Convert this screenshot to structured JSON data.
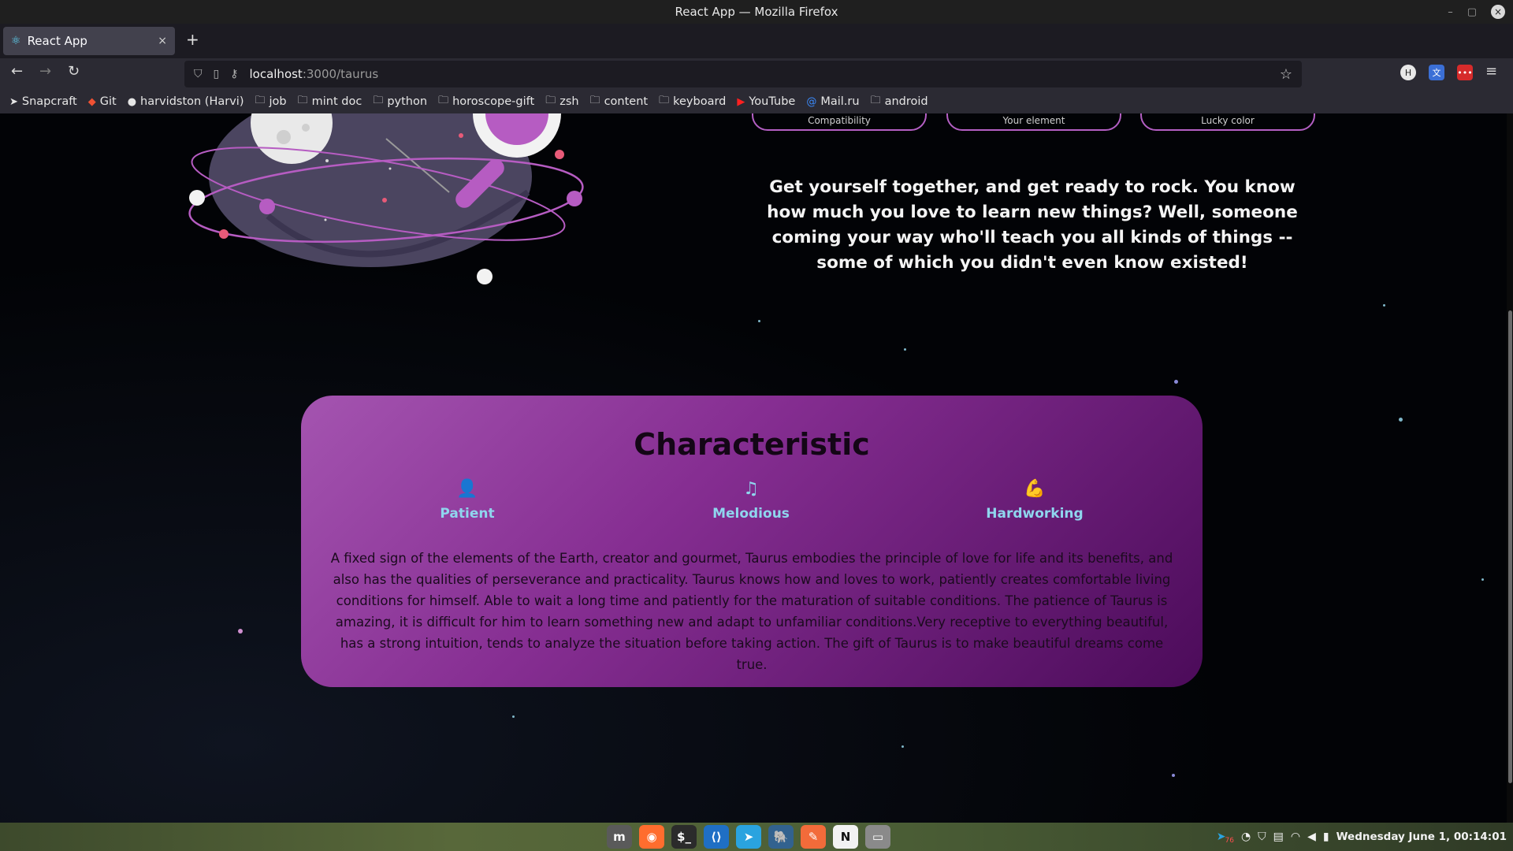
{
  "window": {
    "title": "React App — Mozilla Firefox",
    "minimize": "–",
    "maximize": "▢",
    "close": "×"
  },
  "tab": {
    "title": "React App",
    "close": "×",
    "new_tab": "+"
  },
  "nav": {
    "back": "←",
    "forward": "→",
    "reload": "↻"
  },
  "urlbar": {
    "host": "localhost",
    "path": ":3000/taurus",
    "star": "☆"
  },
  "bookmarks": [
    {
      "label": "Snapcraft",
      "icon": "snapcraft-icon",
      "glyph": "➤"
    },
    {
      "label": "Git",
      "icon": "git-icon",
      "glyph": "◆"
    },
    {
      "label": "harvidston (Harvi)",
      "icon": "github-icon",
      "glyph": "●"
    },
    {
      "label": "job",
      "icon": "folder-icon",
      "glyph": "🗀"
    },
    {
      "label": "mint doc",
      "icon": "folder-icon",
      "glyph": "🗀"
    },
    {
      "label": "python",
      "icon": "folder-icon",
      "glyph": "🗀"
    },
    {
      "label": "horoscope-gift",
      "icon": "folder-icon",
      "glyph": "🗀"
    },
    {
      "label": "zsh",
      "icon": "folder-icon",
      "glyph": "🗀"
    },
    {
      "label": "content",
      "icon": "folder-icon",
      "glyph": "🗀"
    },
    {
      "label": "keyboard",
      "icon": "folder-icon",
      "glyph": "🗀"
    },
    {
      "label": "YouTube",
      "icon": "youtube-icon",
      "glyph": "▶"
    },
    {
      "label": "Mail.ru",
      "icon": "mailru-icon",
      "glyph": "@"
    },
    {
      "label": "android",
      "icon": "folder-icon",
      "glyph": "🗀"
    }
  ],
  "stats": {
    "compatibility": "Compatibility",
    "element": "Your element",
    "lucky_color": "Lucky color"
  },
  "horoscope_text": "Get yourself together, and get ready to rock. You know how much you love to learn new things? Well, someone coming your way who'll teach you all kinds of things -- some of which you didn't even know existed!",
  "characteristic": {
    "title": "Characteristic",
    "traits": [
      {
        "label": "Patient",
        "icon": "person-icon",
        "glyph": "👤"
      },
      {
        "label": "Melodious",
        "icon": "music-note-icon",
        "glyph": "♫"
      },
      {
        "label": "Hardworking",
        "icon": "flexed-arm-icon",
        "glyph": "💪"
      }
    ],
    "description": "A fixed sign of the elements of the Earth, creator and gourmet, Taurus embodies the principle of love for life and its benefits, and also has the qualities of perseverance and practicality. Taurus knows how and loves to work, patiently creates comfortable living conditions for himself. Able to wait a long time and patiently for the maturation of suitable conditions. The patience of Taurus is amazing, it is difficult for him to learn something new and adapt to unfamiliar conditions.Very receptive to everything beautiful, has a strong intuition, tends to analyze the situation before taking action. The gift of Taurus is to make beautiful dreams come true."
  },
  "taskbar": {
    "apps": [
      {
        "name": "mint-menu",
        "glyph": "m",
        "color": "#5a5a5a"
      },
      {
        "name": "firefox",
        "glyph": "◉",
        "color": "#ff6d2e"
      },
      {
        "name": "terminal",
        "glyph": "$_",
        "color": "#2b2b2b"
      },
      {
        "name": "vscode",
        "glyph": "⟨⟩",
        "color": "#1f6fc5"
      },
      {
        "name": "telegram",
        "glyph": "➤",
        "color": "#2aa3df"
      },
      {
        "name": "postgres",
        "glyph": "🐘",
        "color": "#32628f"
      },
      {
        "name": "postman",
        "glyph": "✎",
        "color": "#f26b3a"
      },
      {
        "name": "notion",
        "glyph": "N",
        "color": "#f2f2f2"
      },
      {
        "name": "files",
        "glyph": "▭",
        "color": "#8a8a8a"
      }
    ],
    "badge": "76",
    "clock": "Wednesday June  1, 00:14:01"
  }
}
